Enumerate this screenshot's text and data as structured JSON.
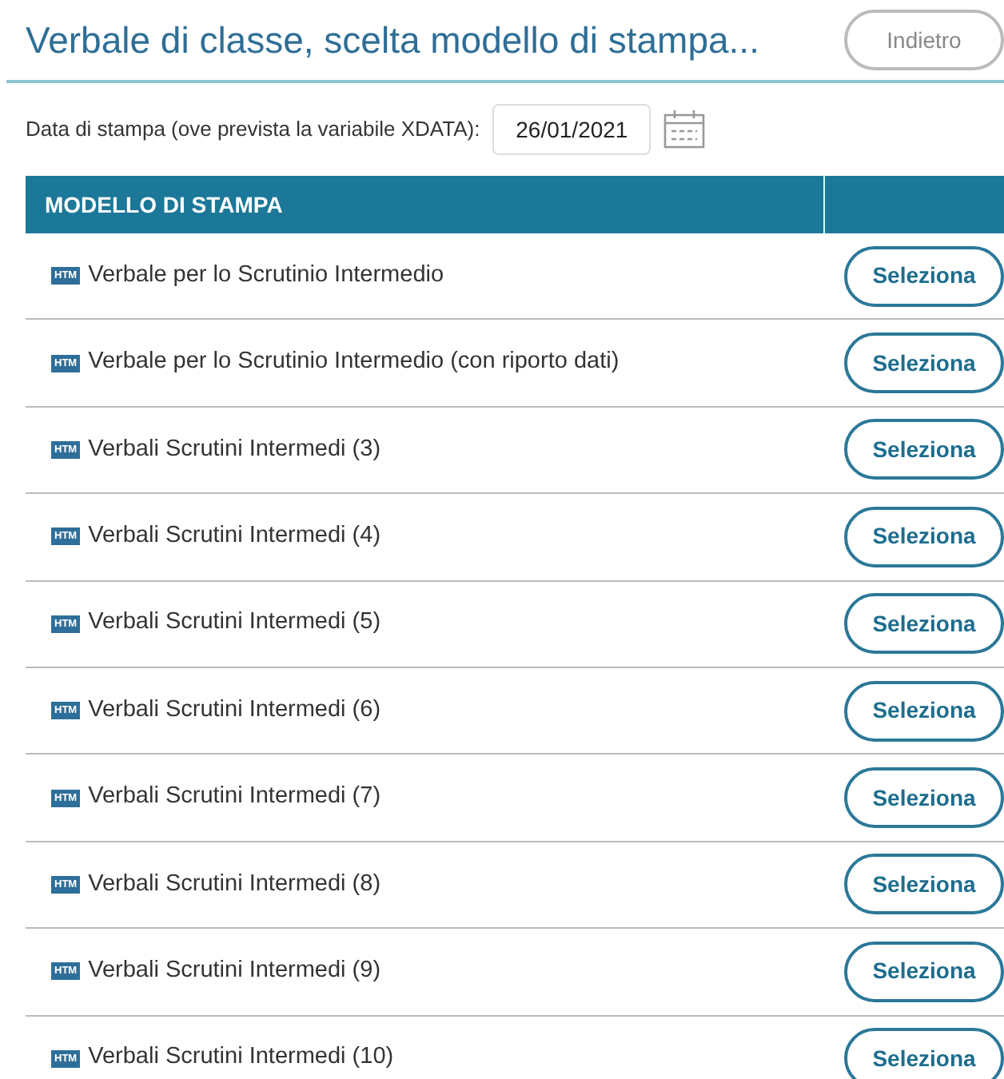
{
  "title": "Verbale di classe, scelta modello di stampa...",
  "back_button": "Indietro",
  "date_label": "Data di stampa (ove prevista la variabile XDATA):",
  "date_value": "26/01/2021",
  "table": {
    "columns": [
      "MODELLO DI STAMPA"
    ],
    "rows": [
      {
        "format": "HTM",
        "name": "Verbale per lo Scrutinio Intermedio",
        "action": "Seleziona"
      },
      {
        "format": "HTM",
        "name": "Verbale per lo Scrutinio Intermedio (con riporto dati)",
        "action": "Seleziona"
      },
      {
        "format": "HTM",
        "name": "Verbali Scrutini Intermedi (3)",
        "action": "Seleziona"
      },
      {
        "format": "HTM",
        "name": "Verbali Scrutini Intermedi (4)",
        "action": "Seleziona"
      },
      {
        "format": "HTM",
        "name": "Verbali Scrutini Intermedi (5)",
        "action": "Seleziona"
      },
      {
        "format": "HTM",
        "name": "Verbali Scrutini Intermedi (6)",
        "action": "Seleziona"
      },
      {
        "format": "HTM",
        "name": "Verbali Scrutini Intermedi (7)",
        "action": "Seleziona"
      },
      {
        "format": "HTM",
        "name": "Verbali Scrutini Intermedi (8)",
        "action": "Seleziona"
      },
      {
        "format": "HTM",
        "name": "Verbali Scrutini Intermedi (9)",
        "action": "Seleziona"
      },
      {
        "format": "HTM",
        "name": "Verbali Scrutini Intermedi (10)",
        "action": "Seleziona"
      }
    ]
  }
}
